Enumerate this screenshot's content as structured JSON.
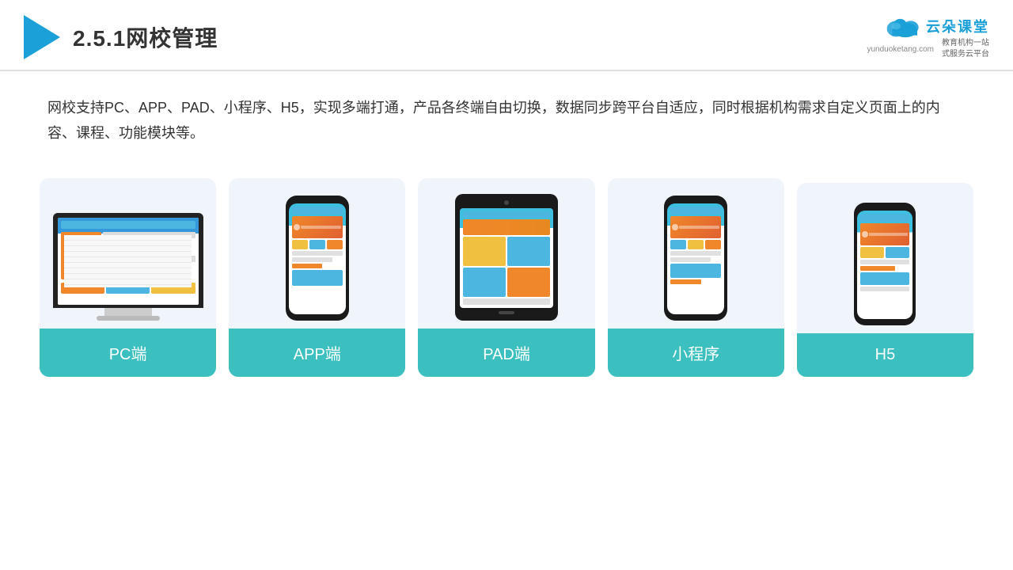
{
  "header": {
    "title": "2.5.1网校管理",
    "brand": {
      "name": "云朵课堂",
      "url": "yunduoketang.com",
      "tagline": "教育机构一站\n式服务云平台"
    }
  },
  "description": {
    "text": "网校支持PC、APP、PAD、小程序、H5，实现多端打通，产品各终端自由切换，数据同步跨平台自适应，同时根据机构需求自定义页面上的内容、课程、功能模块等。"
  },
  "cards": [
    {
      "id": "pc",
      "label": "PC端"
    },
    {
      "id": "app",
      "label": "APP端"
    },
    {
      "id": "pad",
      "label": "PAD端"
    },
    {
      "id": "miniprogram",
      "label": "小程序"
    },
    {
      "id": "h5",
      "label": "H5"
    }
  ]
}
